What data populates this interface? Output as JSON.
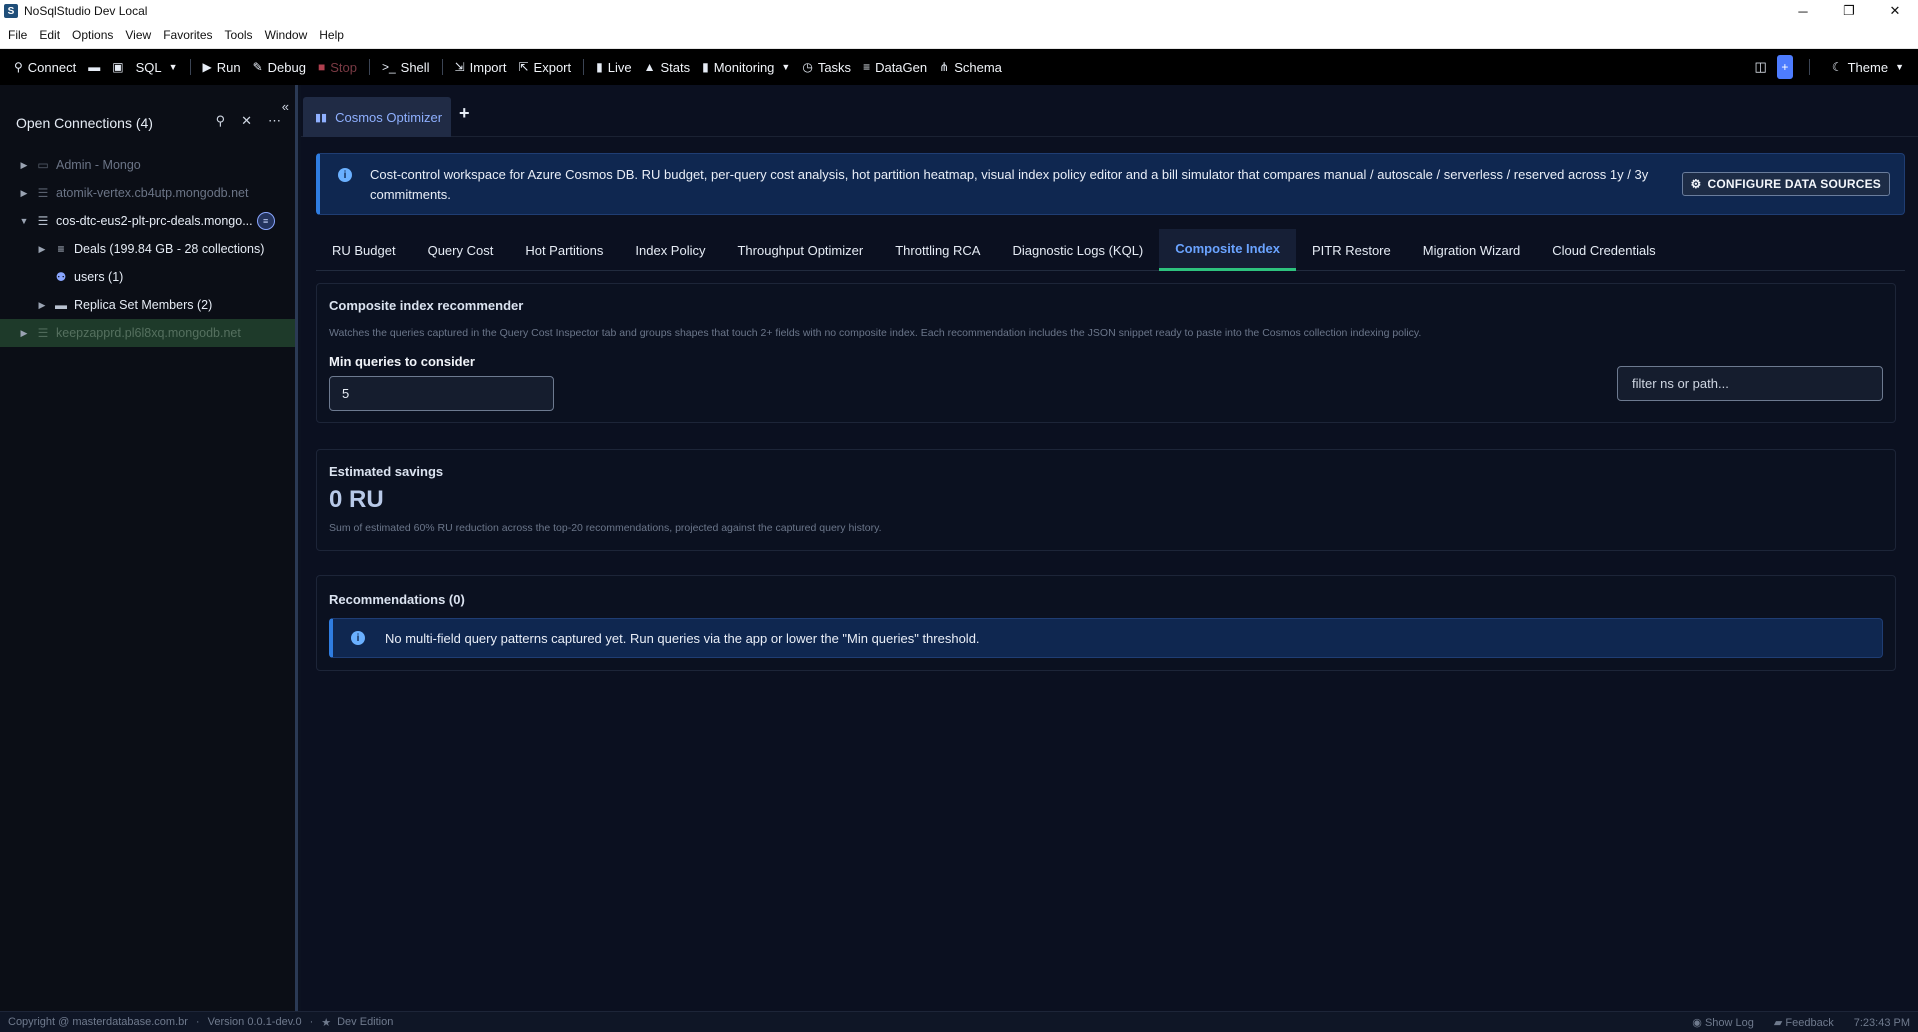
{
  "window": {
    "title": "NoSqlStudio Dev Local",
    "app_icon": "S",
    "buttons": {
      "minimize": "─",
      "maximize": "❐",
      "close": "✕"
    }
  },
  "menu": [
    "File",
    "Edit",
    "Options",
    "View",
    "Favorites",
    "Tools",
    "Window",
    "Help"
  ],
  "toolbar": {
    "connect": "Connect",
    "sql": "SQL",
    "run": "Run",
    "debug": "Debug",
    "stop": "Stop",
    "shell": "Shell",
    "import": "Import",
    "export": "Export",
    "live": "Live",
    "stats": "Stats",
    "monitoring": "Monitoring",
    "tasks": "Tasks",
    "datagen": "DataGen",
    "schema": "Schema",
    "plus": "+",
    "theme": "Theme"
  },
  "sidebar": {
    "title": "Open Connections (4)",
    "items": [
      {
        "label": "Admin - Mongo",
        "icon": "monitor-icon"
      },
      {
        "label": "atomik-vertex.cb4utp.mongodb.net",
        "icon": "server-icon"
      },
      {
        "label": "cos-dtc-eus2-plt-prc-deals.mongo...",
        "icon": "server-icon"
      },
      {
        "label": "Deals (199.84 GB - 28 collections)",
        "icon": "database-icon"
      },
      {
        "label": "users (1)",
        "icon": "users-icon"
      },
      {
        "label": "Replica Set Members (2)",
        "icon": "folder-icon"
      },
      {
        "label": "keepzapprd.pl6l8xq.mongodb.net",
        "icon": "server-icon"
      }
    ]
  },
  "tabs": {
    "doc_tab": "Cosmos Optimizer",
    "add": "+"
  },
  "info": {
    "text": "Cost-control workspace for Azure Cosmos DB. RU budget, per-query cost analysis, hot partition heatmap, visual index policy editor and a bill simulator that compares manual / autoscale / serverless / reserved across 1y / 3y commitments.",
    "button": "CONFIGURE DATA SOURCES"
  },
  "subtabs": [
    "RU Budget",
    "Query Cost",
    "Hot Partitions",
    "Index Policy",
    "Throughput Optimizer",
    "Throttling RCA",
    "Diagnostic Logs (KQL)",
    "Composite Index",
    "PITR Restore",
    "Migration Wizard",
    "Cloud Credentials"
  ],
  "recommender": {
    "title": "Composite index recommender",
    "description": "Watches the queries captured in the Query Cost Inspector tab and groups shapes that touch 2+ fields with no composite index. Each recommendation includes the JSON snippet ready to paste into the Cosmos collection indexing policy.",
    "min_label": "Min queries to consider",
    "min_value": "5",
    "filter_placeholder": "filter ns or path..."
  },
  "savings": {
    "title": "Estimated savings",
    "value": "0 RU",
    "note": "Sum of estimated 60% RU reduction across the top-20 recommendations, projected against the captured query history."
  },
  "recommendations": {
    "title": "Recommendations (0)",
    "empty": "No multi-field query patterns captured yet. Run queries via the app or lower the \"Min queries\" threshold."
  },
  "status": {
    "copyright": "Copyright @ masterdatabase.com.br",
    "version": "Version 0.0.1-dev.0",
    "edition": "Dev Edition",
    "show_log": "Show Log",
    "feedback": "Feedback",
    "time": "7:23:43 PM"
  },
  "colors": {
    "accent": "#6aa3ff",
    "active_tab_underline": "#2ec27e",
    "info_bg": "#0f2750"
  }
}
